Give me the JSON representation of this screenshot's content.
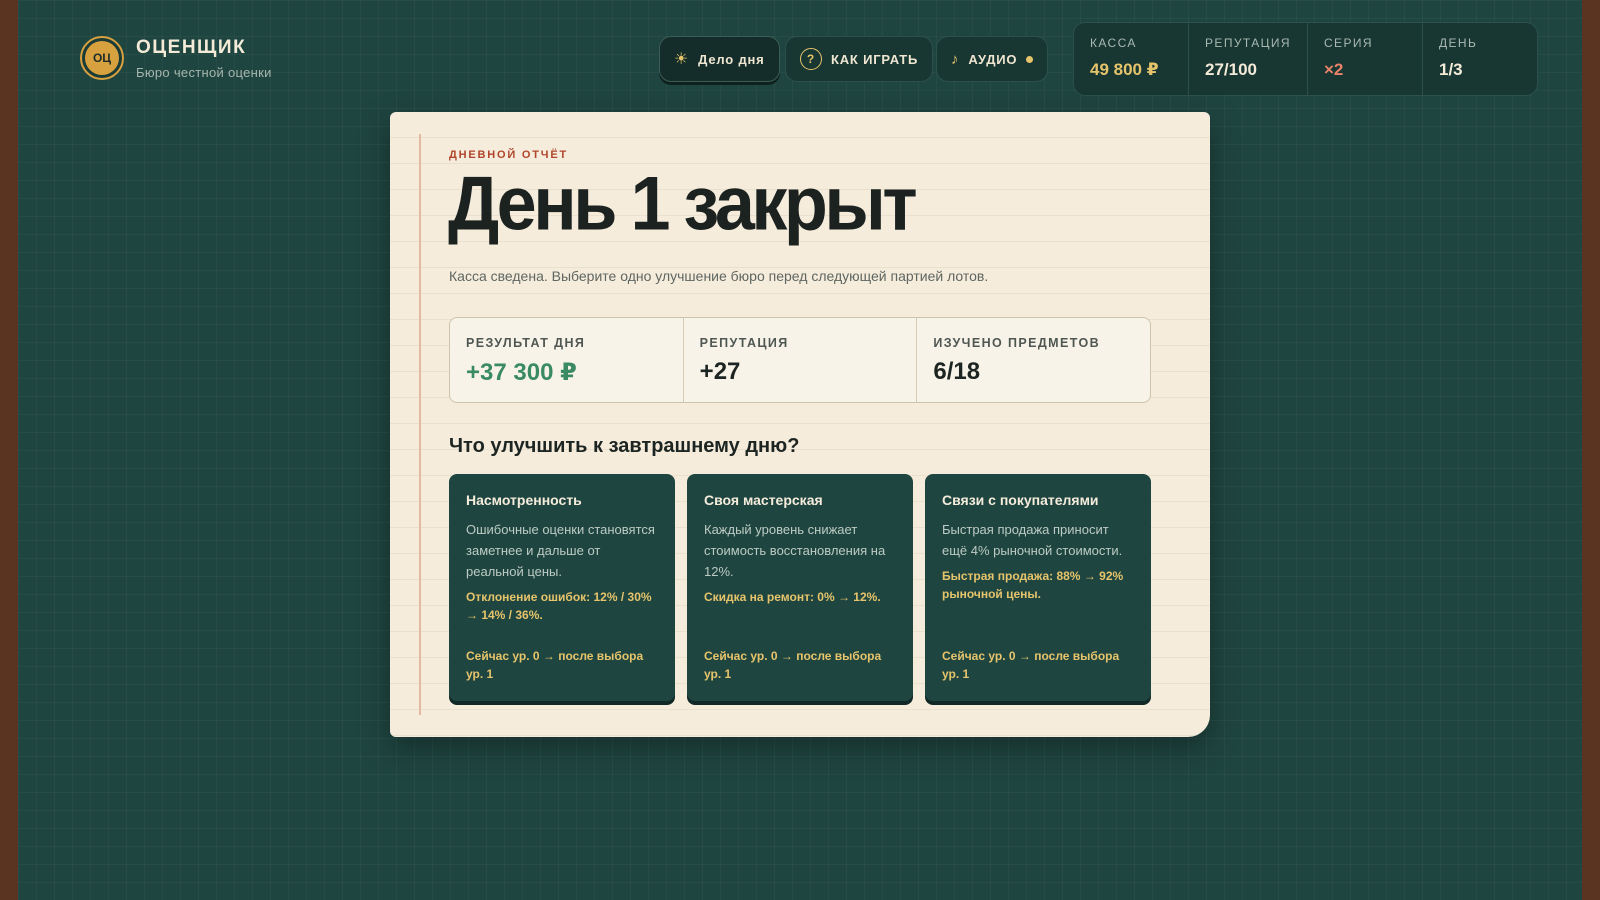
{
  "header": {
    "logo_text": "ОЦ",
    "title": "ОЦЕНЩИК",
    "subtitle": "Бюро честной оценки"
  },
  "toolbar": {
    "daily_case_label": "Дело дня",
    "how_to_play_label": "КАК ИГРАТЬ",
    "audio_label": "АУДИО"
  },
  "stats": [
    {
      "label": "КАССА",
      "value": "49 800 ₽"
    },
    {
      "label": "РЕПУТАЦИЯ",
      "value": "27/100"
    },
    {
      "label": "СЕРИЯ",
      "value": "×2"
    },
    {
      "label": "ДЕНЬ",
      "value": "1/3"
    }
  ],
  "report": {
    "kicker": "ДНЕВНОЙ ОТЧЁТ",
    "title": "День 1 закрыт",
    "subtitle": "Касса сведена. Выберите одно улучшение бюро перед следующей партией лотов.",
    "results": [
      {
        "label": "РЕЗУЛЬТАТ ДНЯ",
        "value": "+37 300 ₽"
      },
      {
        "label": "РЕПУТАЦИЯ",
        "value": "+27"
      },
      {
        "label": "ИЗУЧЕНО ПРЕДМЕТОВ",
        "value": "6/18"
      }
    ],
    "question": "Что улучшить к завтрашнему дню?",
    "options": [
      {
        "title": "Насмотренность",
        "description": "Ошибочные оценки становятся заметнее и дальше от реальной цены.",
        "effect": "Отклонение ошибок: 12% / 30% → 14% / 36%.",
        "level": "Сейчас ур. 0 → после выбора ур. 1"
      },
      {
        "title": "Своя мастерская",
        "description": "Каждый уровень снижает стоимость восстановления на 12%.",
        "effect": "Скидка на ремонт: 0% → 12%.",
        "level": "Сейчас ур. 0 → после выбора ур. 1"
      },
      {
        "title": "Связи с покупателями",
        "description": "Быстрая продажа приносит ещё 4% рыночной стоимости.",
        "effect": "Быстрая продажа: 88% → 92% рыночной цены.",
        "level": "Сейчас ур. 0 → после выбора ур. 1"
      }
    ]
  },
  "colors": {
    "background": "#1f4540",
    "paper": "#f5ecdc",
    "accent_gold": "#e6c46b",
    "accent_red": "#b0452b",
    "positive_green": "#3a8a63",
    "streak": "#e8826a"
  },
  "icons": {
    "daily_case": "sun-icon",
    "how_to_play": "question-icon",
    "audio": "music-note-icon",
    "audio_status": "status-dot-icon"
  }
}
